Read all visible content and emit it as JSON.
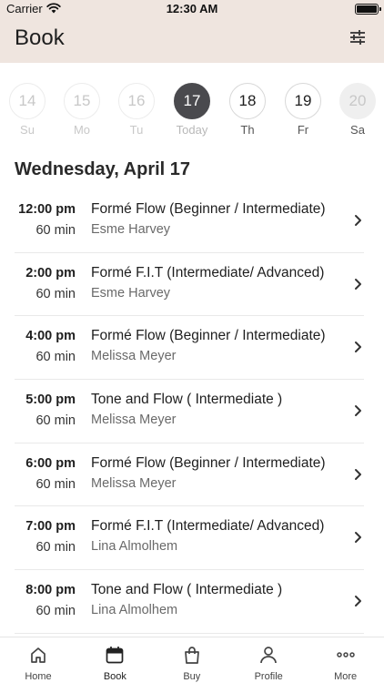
{
  "status_bar": {
    "carrier": "Carrier",
    "time": "12:30 AM"
  },
  "header": {
    "title": "Book",
    "filter_icon": "sliders-icon"
  },
  "week": [
    {
      "num": "14",
      "label": "Su",
      "state": "past"
    },
    {
      "num": "15",
      "label": "Mo",
      "state": "past"
    },
    {
      "num": "16",
      "label": "Tu",
      "state": "past"
    },
    {
      "num": "17",
      "label": "Today",
      "state": "today"
    },
    {
      "num": "18",
      "label": "Th",
      "state": "future"
    },
    {
      "num": "19",
      "label": "Fr",
      "state": "future"
    },
    {
      "num": "20",
      "label": "Sa",
      "state": "off"
    }
  ],
  "date_heading": "Wednesday, April 17",
  "classes": [
    {
      "time": "12:00 pm",
      "duration": "60 min",
      "name": "Formé Flow (Beginner / Intermediate)",
      "teacher": "Esme Harvey"
    },
    {
      "time": "2:00 pm",
      "duration": "60 min",
      "name": "Formé F.I.T (Intermediate/ Advanced)",
      "teacher": "Esme Harvey"
    },
    {
      "time": "4:00 pm",
      "duration": "60 min",
      "name": "Formé Flow (Beginner / Intermediate)",
      "teacher": "Melissa Meyer"
    },
    {
      "time": "5:00 pm",
      "duration": "60 min",
      "name": "Tone and Flow ( Intermediate )",
      "teacher": "Melissa Meyer"
    },
    {
      "time": "6:00 pm",
      "duration": "60 min",
      "name": "Formé Flow (Beginner / Intermediate)",
      "teacher": "Melissa Meyer"
    },
    {
      "time": "7:00 pm",
      "duration": "60 min",
      "name": "Formé F.I.T (Intermediate/ Advanced)",
      "teacher": "Lina Almolhem"
    },
    {
      "time": "8:00 pm",
      "duration": "60 min",
      "name": "Tone and Flow ( Intermediate )",
      "teacher": "Lina Almolhem"
    }
  ],
  "tabs": [
    {
      "label": "Home",
      "icon": "home-icon",
      "active": false
    },
    {
      "label": "Book",
      "icon": "calendar-icon",
      "active": true
    },
    {
      "label": "Buy",
      "icon": "shopping-bag-icon",
      "active": false
    },
    {
      "label": "Profile",
      "icon": "person-icon",
      "active": false
    },
    {
      "label": "More",
      "icon": "more-dots-icon",
      "active": false
    }
  ],
  "colors": {
    "header_bg": "#efe5df",
    "today_bg": "#4a4a4e",
    "accent_text": "#1e1e1e",
    "muted": "#c8c8c8"
  }
}
